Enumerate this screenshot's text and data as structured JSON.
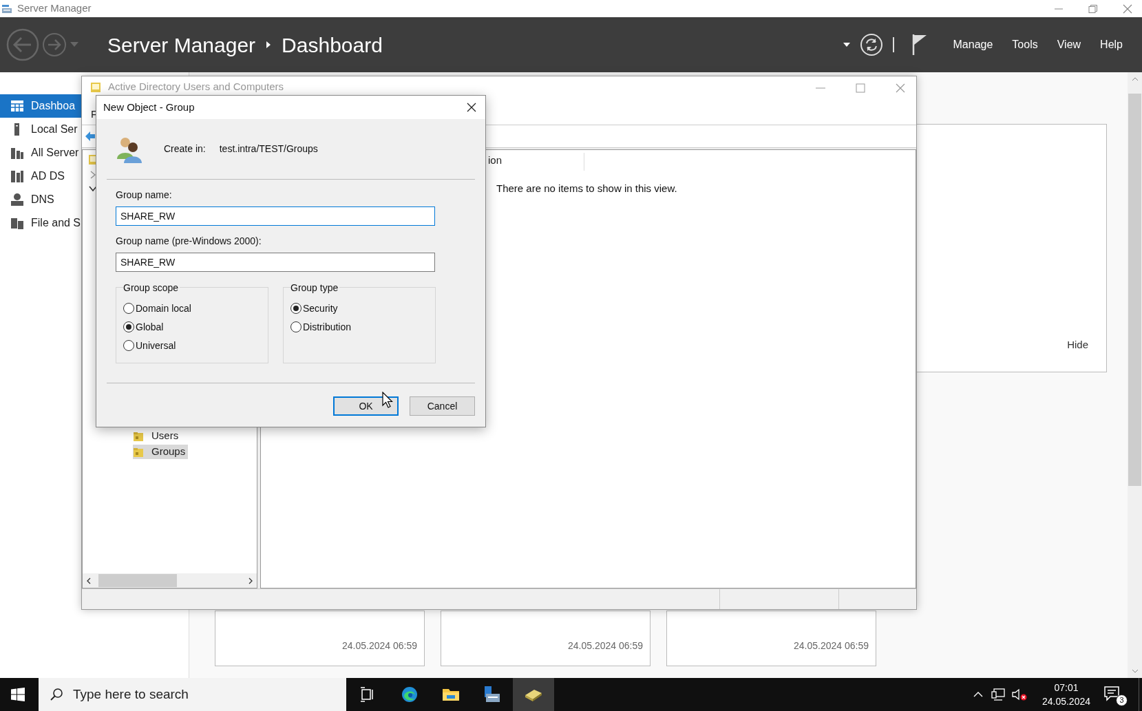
{
  "app_title": "Server Manager",
  "header": {
    "breadcrumb": [
      "Server Manager",
      "Dashboard"
    ],
    "menu": [
      "Manage",
      "Tools",
      "View",
      "Help"
    ]
  },
  "sidebar": {
    "items": [
      {
        "label": "Dashboa",
        "kind": "dashboard",
        "selected": true
      },
      {
        "label": "Local Ser",
        "kind": "server",
        "selected": false
      },
      {
        "label": "All Server",
        "kind": "servers",
        "selected": false
      },
      {
        "label": "AD DS",
        "kind": "adds",
        "selected": false
      },
      {
        "label": "DNS",
        "kind": "dns",
        "selected": false
      },
      {
        "label": "File and S",
        "kind": "files",
        "selected": false
      }
    ]
  },
  "panel": {
    "hide_link": "Hide"
  },
  "tiles": [
    {
      "timestamp": "24.05.2024 06:59"
    },
    {
      "timestamp": "24.05.2024 06:59"
    },
    {
      "timestamp": "24.05.2024 06:59"
    }
  ],
  "aduc": {
    "title": "Active Directory Users and Computers",
    "menu": [
      "F"
    ],
    "tree": [
      {
        "label": "Users",
        "selected": false
      },
      {
        "label": "Groups",
        "selected": true
      }
    ],
    "columns": [
      "ion"
    ],
    "empty_message": "There are no items to show in this view."
  },
  "dialog": {
    "title": "New Object - Group",
    "create_in_label": "Create in:",
    "create_in_path": "test.intra/TEST/Groups",
    "fields": [
      {
        "label": "Group name:",
        "value": "SHARE_RW",
        "focused": true
      },
      {
        "label": "Group name (pre-Windows 2000):",
        "value": "SHARE_RW",
        "focused": false
      }
    ],
    "groups": [
      {
        "title": "Group scope",
        "options": [
          {
            "label": "Domain local",
            "selected": false
          },
          {
            "label": "Global",
            "selected": true
          },
          {
            "label": "Universal",
            "selected": false
          }
        ]
      },
      {
        "title": "Group type",
        "options": [
          {
            "label": "Security",
            "selected": true
          },
          {
            "label": "Distribution",
            "selected": false
          }
        ]
      }
    ],
    "buttons": [
      {
        "label": "OK",
        "default": true
      },
      {
        "label": "Cancel",
        "default": false
      }
    ]
  },
  "taskbar": {
    "search_placeholder": "Type here to search",
    "apps": [
      {
        "kind": "taskview",
        "active": false
      },
      {
        "kind": "browser",
        "active": false
      },
      {
        "kind": "explorer",
        "active": false
      },
      {
        "kind": "servermanager",
        "active": false
      },
      {
        "kind": "aduc",
        "active": true
      }
    ],
    "time": "07:01",
    "date": "24.05.2024",
    "notifications": "3"
  }
}
